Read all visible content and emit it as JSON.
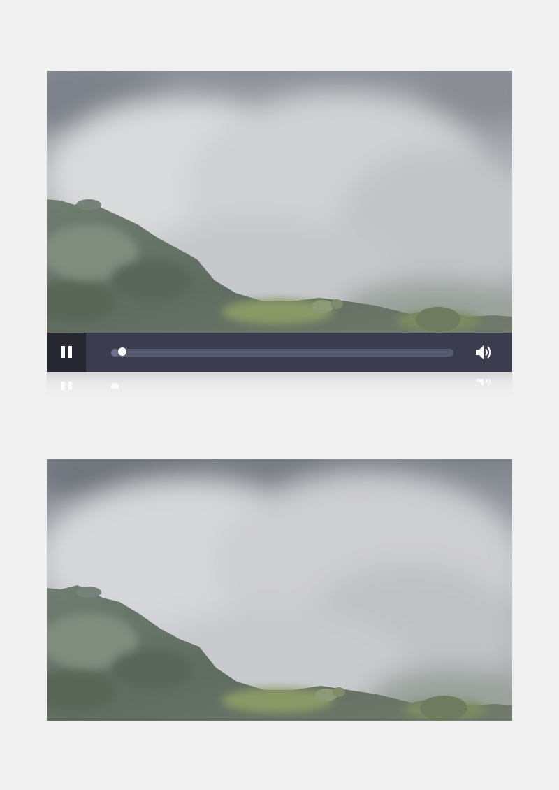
{
  "player": {
    "state": "playing",
    "play_pause_icon": "pause-icon",
    "volume_icon": "volume-icon",
    "progress": 0.02
  },
  "colors": {
    "page_background": "#f0f0f0",
    "control_bar": "#3b3d4e",
    "pause_button_bg": "#25262f",
    "progress_track": "#585a70",
    "icon": "#ffffff"
  },
  "frames": [
    {
      "name": "video-frame-top",
      "scene": "volcanic-steam-over-rocky-slope"
    },
    {
      "name": "video-frame-bottom",
      "scene": "volcanic-steam-over-rocky-slope"
    }
  ]
}
